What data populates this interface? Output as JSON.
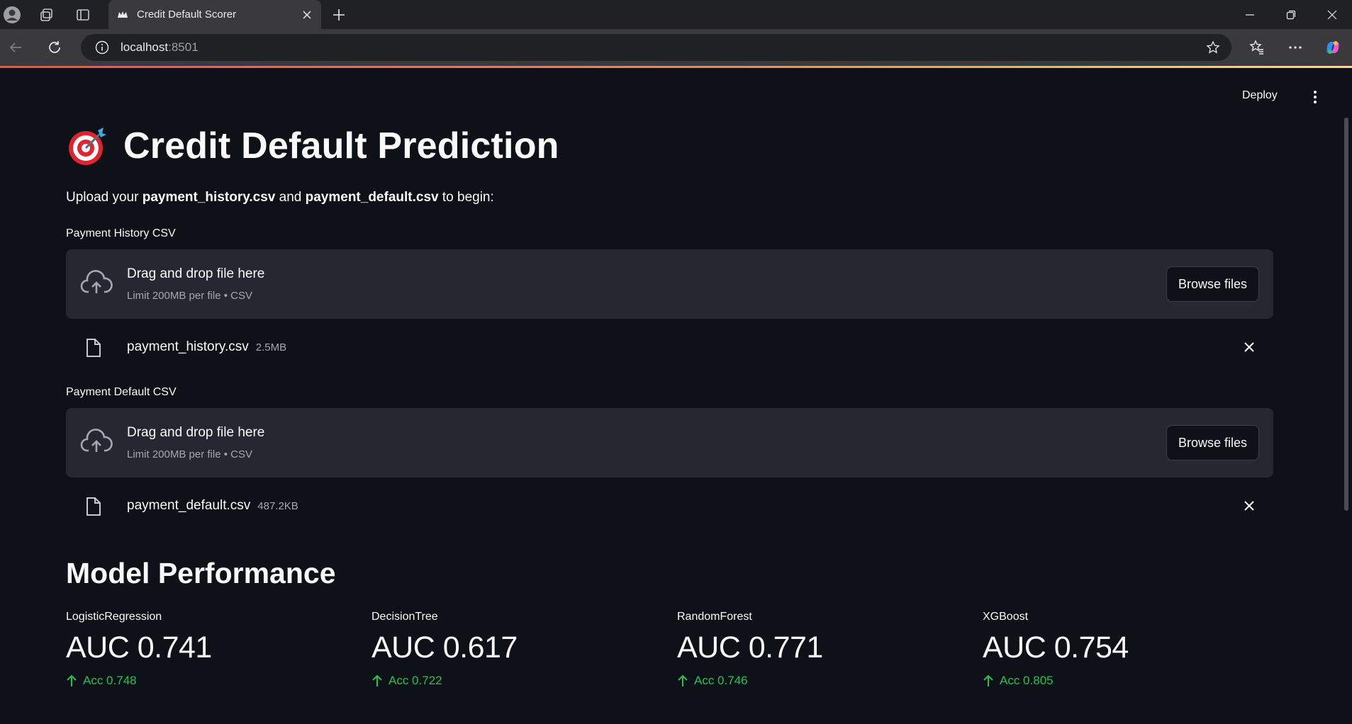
{
  "browser": {
    "tab_title": "Credit Default Scorer",
    "url_host": "localhost",
    "url_port": ":8501"
  },
  "toolbar": {
    "deploy_label": "Deploy"
  },
  "page": {
    "title": "Credit Default Prediction",
    "intro_prefix": "Upload your ",
    "intro_file1": "payment_history.csv",
    "intro_mid": " and ",
    "intro_file2": "payment_default.csv",
    "intro_suffix": " to begin:"
  },
  "uploaders": [
    {
      "label": "Payment History CSV",
      "drop_text": "Drag and drop file here",
      "limit_text": "Limit 200MB per file • CSV",
      "button_label": "Browse files",
      "file_name": "payment_history.csv",
      "file_size": "2.5MB"
    },
    {
      "label": "Payment Default CSV",
      "drop_text": "Drag and drop file here",
      "limit_text": "Limit 200MB per file • CSV",
      "button_label": "Browse files",
      "file_name": "payment_default.csv",
      "file_size": "487.2KB"
    }
  ],
  "performance": {
    "title": "Model Performance",
    "metrics": [
      {
        "label": "LogisticRegression",
        "value": "AUC 0.741",
        "delta": "Acc 0.748"
      },
      {
        "label": "DecisionTree",
        "value": "AUC 0.617",
        "delta": "Acc 0.722"
      },
      {
        "label": "RandomForest",
        "value": "AUC 0.771",
        "delta": "Acc 0.746"
      },
      {
        "label": "XGBoost",
        "value": "AUC 0.754",
        "delta": "Acc 0.805"
      }
    ]
  },
  "colors": {
    "background": "#0e1117",
    "dropzone": "#262730",
    "delta_positive": "#21c354",
    "text": "#fafafa",
    "muted": "#a3a8b4"
  },
  "icons": [
    "profile-icon",
    "workspaces-icon",
    "tab-actions-icon",
    "favicon-icon",
    "tab-close-icon",
    "new-tab-icon",
    "minimize-icon",
    "restore-icon",
    "close-window-icon",
    "back-icon",
    "refresh-icon",
    "site-info-icon",
    "star-icon",
    "favorites-icon",
    "more-icon",
    "copilot-icon",
    "kebab-menu-icon",
    "target-icon",
    "cloud-upload-icon",
    "file-icon",
    "remove-file-icon",
    "arrow-up-icon"
  ]
}
